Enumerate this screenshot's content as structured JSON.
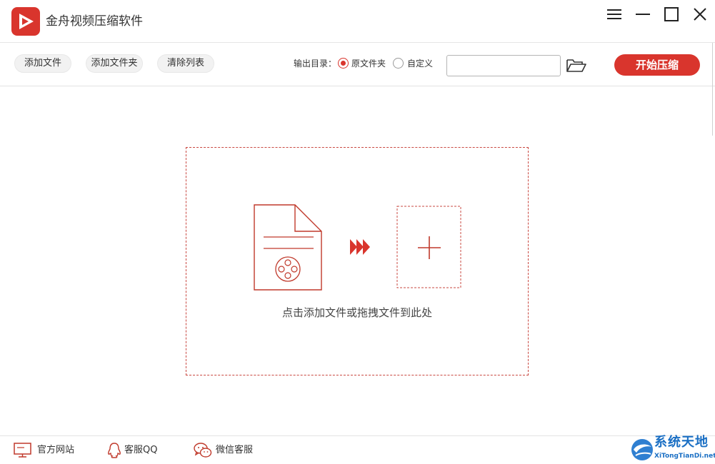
{
  "window": {
    "title": "金舟视频压缩软件"
  },
  "toolbar": {
    "add_file_label": "添加文件",
    "add_folder_label": "添加文件夹",
    "clear_list_label": "清除列表",
    "output_dir_label": "输出目录：",
    "output_options": [
      {
        "label": "原文件夹",
        "selected": true
      },
      {
        "label": "自定义",
        "selected": false
      }
    ],
    "path_value": "",
    "start_label": "开始压缩"
  },
  "drop_area": {
    "hint": "点击添加文件或拖拽文件到此处"
  },
  "footer": {
    "links": [
      {
        "label": "官方网站",
        "icon": "monitor-icon"
      },
      {
        "label": "客服QQ",
        "icon": "qq-icon"
      },
      {
        "label": "微信客服",
        "icon": "wechat-icon"
      }
    ]
  },
  "watermark": {
    "title": "系统天地",
    "subtitle": "XiTongTianDi.net"
  },
  "colors": {
    "accent": "#d9352d",
    "watermark_blue": "#1a6fc4"
  }
}
